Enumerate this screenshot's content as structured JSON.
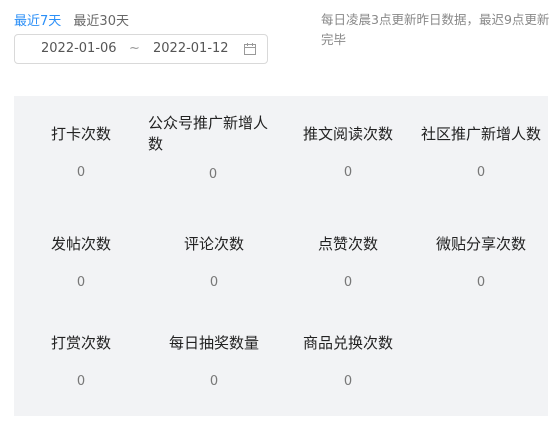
{
  "range": {
    "last7": "最近7天",
    "last30": "最近30天"
  },
  "notice": "每日凌晨3点更新昨日数据，最迟9点更新完毕",
  "date_picker": {
    "start": "2022-01-06",
    "separator": "~",
    "end": "2022-01-12",
    "icon": "calendar-icon"
  },
  "accent_color": "#2b8ff7",
  "stats": [
    {
      "label": "打卡次数",
      "value": "0"
    },
    {
      "label": "公众号推广新增人数",
      "value": "0"
    },
    {
      "label": "推文阅读次数",
      "value": "0"
    },
    {
      "label": "社区推广新增人数",
      "value": "0"
    },
    {
      "label": "发帖次数",
      "value": "0"
    },
    {
      "label": "评论次数",
      "value": "0"
    },
    {
      "label": "点赞次数",
      "value": "0"
    },
    {
      "label": "微贴分享次数",
      "value": "0"
    },
    {
      "label": "打赏次数",
      "value": "0"
    },
    {
      "label": "每日抽奖数量",
      "value": "0"
    },
    {
      "label": "商品兑换次数",
      "value": "0"
    }
  ]
}
